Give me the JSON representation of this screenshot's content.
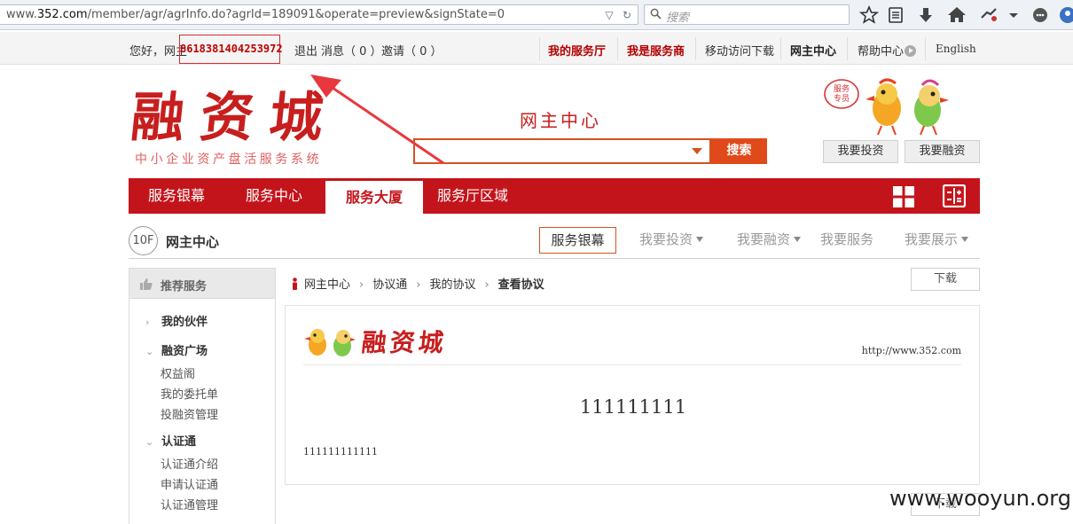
{
  "browser": {
    "url_prefix": "www.",
    "url_host": "352.com",
    "url_path": "/member/agr/agrInfo.do?agrId=189091&operate=preview&signState=0",
    "search_placeholder": "搜索"
  },
  "topnav": {
    "greeting": "您好，网主",
    "phone": "8618381404253972",
    "logout": "退出",
    "messages": "消息（ 0 ）",
    "invites": "邀请（ 0 ）",
    "links": [
      "我的服务厅",
      "我是服务商",
      "移动访问下载",
      "网主中心",
      "帮助中心",
      "English"
    ]
  },
  "header": {
    "logo_text": "融资城",
    "logo_sub": "中小企业资产盘活服务系统",
    "title": "网主中心",
    "search_button": "搜索",
    "mascot_badge": "服务专员",
    "invest_button": "我要投资",
    "finance_button": "我要融资"
  },
  "menu": {
    "items": [
      "服务银幕",
      "服务中心",
      "服务大厦",
      "服务厅区域"
    ],
    "active_index": 2
  },
  "floor": {
    "label": "10F",
    "title": "网主中心",
    "tabs": [
      "服务银幕",
      "我要投资",
      "我要融资",
      "我要服务",
      "我要展示"
    ],
    "active_index": 0
  },
  "sidebar": {
    "header": "推荐服务",
    "groups": [
      {
        "label": "我的伙伴",
        "expanded": false,
        "items": []
      },
      {
        "label": "融资广场",
        "expanded": true,
        "items": [
          "权益阁",
          "我的委托单",
          "投融资管理"
        ]
      },
      {
        "label": "认证通",
        "expanded": true,
        "items": [
          "认证通介绍",
          "申请认证通",
          "认证通管理"
        ]
      }
    ]
  },
  "breadcrumb": [
    "网主中心",
    "协议通",
    "我的协议",
    "查看协议"
  ],
  "download_label": "下载",
  "document": {
    "brand": "融资城",
    "site_url": "http://www.352.com",
    "title": "111111111",
    "body": "111111111111"
  },
  "watermark": "www.wooyun.org",
  "colors": {
    "brand_red": "#c4141b",
    "search_orange": "#e04a1a",
    "annotation_red": "#e8383d"
  }
}
